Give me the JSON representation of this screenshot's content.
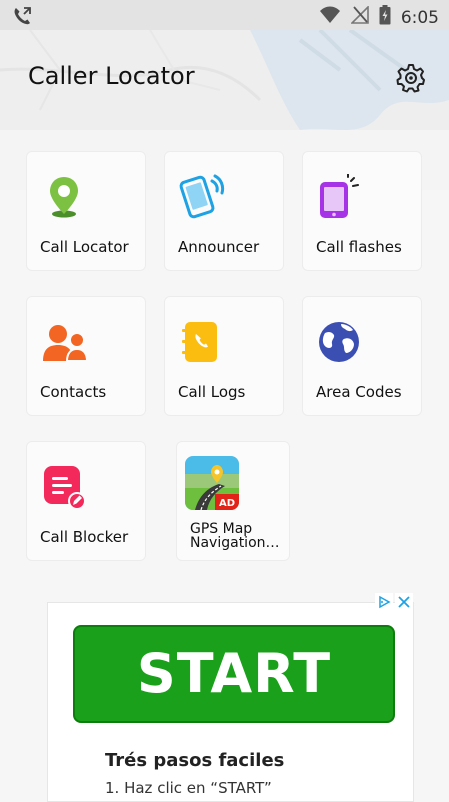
{
  "status_bar": {
    "time": "6:05",
    "icons": [
      "call-forwarding-icon",
      "wifi-icon",
      "no-signal-icon",
      "battery-charging-icon"
    ]
  },
  "header": {
    "title": "Caller Locator",
    "settings_icon": "gear-icon"
  },
  "tiles": [
    {
      "label": "Call Locator",
      "icon": "location-pin-icon",
      "color": "#7dc142"
    },
    {
      "label": "Announcer",
      "icon": "phone-ringing-icon",
      "color": "#1ea2e4"
    },
    {
      "label": "Call flashes",
      "icon": "tablet-flash-icon",
      "color": "#a733e6"
    },
    {
      "label": "Contacts",
      "icon": "contacts-icon",
      "color": "#f26522"
    },
    {
      "label": "Call Logs",
      "icon": "call-logs-icon",
      "color": "#fbbd10"
    },
    {
      "label": "Area Codes",
      "icon": "globe-icon",
      "color": "#3b4fb3"
    },
    {
      "label": "Call Blocker",
      "icon": "call-blocker-icon",
      "color": "#f2295a"
    },
    {
      "label": "GPS Map Navigation…",
      "label_line1": "GPS Map",
      "label_line2": "Navigation…",
      "icon": "gps-map-app-icon",
      "badge": "AD"
    }
  ],
  "ad": {
    "button_label": "START",
    "heading": "Trés pasos faciles",
    "step1": "1. Haz clic en “START”",
    "controls": [
      "adchoices-icon",
      "close-icon"
    ],
    "accent": "#1aa01a"
  }
}
